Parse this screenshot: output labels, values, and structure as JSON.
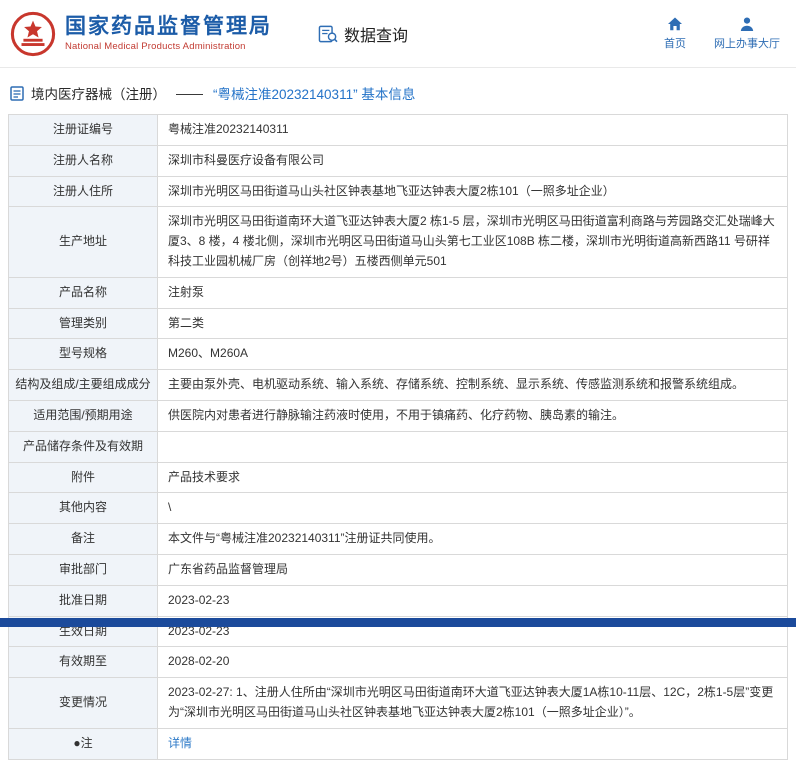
{
  "header": {
    "agency_cn": "国家药品监督管理局",
    "agency_en": "National Medical Products Administration",
    "data_query": "数据查询",
    "nav_home": "首页",
    "nav_hall": "网上办事大厅"
  },
  "breadcrumb": {
    "section": "境内医疗器械（注册）",
    "separator": "——",
    "title": "“粤械注准20232140311” 基本信息"
  },
  "colors": {
    "brand_blue": "#1c5ca8",
    "brand_red": "#c23b32",
    "nav_blue": "#2e6db4",
    "link_blue": "#2f7bc8",
    "label_bg": "#f0f4f9",
    "footer_blue": "#1b4a9b"
  },
  "table": {
    "rows": [
      {
        "label": "注册证编号",
        "value": "粤械注准20232140311"
      },
      {
        "label": "注册人名称",
        "value": "深圳市科曼医疗设备有限公司"
      },
      {
        "label": "注册人住所",
        "value": "深圳市光明区马田街道马山头社区钟表基地飞亚达钟表大厦2栋101（一照多址企业）"
      },
      {
        "label": "生产地址",
        "value": "深圳市光明区马田街道南环大道飞亚达钟表大厦2 栋1-5 层，深圳市光明区马田街道富利商路与芳园路交汇处瑞峰大厦3、8 楼，4 楼北侧，深圳市光明区马田街道马山头第七工业区108B 栋二楼，深圳市光明街道高新西路11 号研祥科技工业园机械厂房（创祥地2号）五楼西侧单元501"
      },
      {
        "label": "产品名称",
        "value": "注射泵"
      },
      {
        "label": "管理类别",
        "value": "第二类"
      },
      {
        "label": "型号规格",
        "value": "M260、M260A"
      },
      {
        "label": "结构及组成/主要组成成分",
        "value": "主要由泵外壳、电机驱动系统、输入系统、存储系统、控制系统、显示系统、传感监测系统和报警系统组成。"
      },
      {
        "label": "适用范围/预期用途",
        "value": "供医院内对患者进行静脉输注药液时使用，不用于镇痛药、化疗药物、胰岛素的输注。"
      },
      {
        "label": "产品储存条件及有效期",
        "value": ""
      },
      {
        "label": "附件",
        "value": "产品技术要求"
      },
      {
        "label": "其他内容",
        "value": "\\"
      },
      {
        "label": "备注",
        "value": "本文件与“粤械注准20232140311”注册证共同使用。"
      },
      {
        "label": "审批部门",
        "value": "广东省药品监督管理局"
      },
      {
        "label": "批准日期",
        "value": "2023-02-23"
      },
      {
        "label": "生效日期",
        "value": "2023-02-23"
      },
      {
        "label": "有效期至",
        "value": "2028-02-20"
      },
      {
        "label": "变更情况",
        "value": "2023-02-27: 1、注册人住所由“深圳市光明区马田街道南环大道飞亚达钟表大厦1A栋10-11层、12C，2栋1-5层”变更为“深圳市光明区马田街道马山头社区钟表基地飞亚达钟表大厦2栋101（一照多址企业）”。"
      },
      {
        "label": "●注",
        "value": "详情",
        "link": true
      }
    ]
  }
}
